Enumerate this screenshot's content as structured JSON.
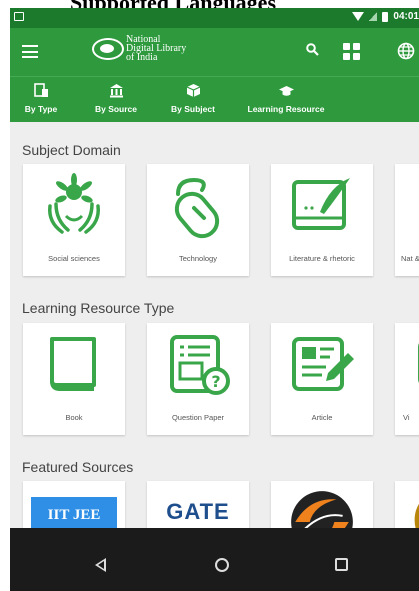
{
  "page_caption": "Supported Languages",
  "status_bar": {
    "time": "04:01"
  },
  "app_bar": {
    "logo_lines": [
      "National",
      "Digital Library",
      "of India"
    ]
  },
  "tabs": [
    {
      "label": "By Type",
      "icon": "file-phone-icon"
    },
    {
      "label": "By Source",
      "icon": "institution-icon"
    },
    {
      "label": "By Subject",
      "icon": "cube-book-icon"
    },
    {
      "label": "Learning Resource",
      "icon": "graduation-cap-icon"
    }
  ],
  "sections": {
    "subject_domain": {
      "title": "Subject Domain",
      "items": [
        {
          "label": "Social sciences",
          "icon": "people-hands-icon"
        },
        {
          "label": "Technology",
          "icon": "mouse-cable-icon"
        },
        {
          "label": "Literature & rhetoric",
          "icon": "quill-paper-icon"
        },
        {
          "label": "Nat & n",
          "icon": "science-icon"
        }
      ]
    },
    "learning_resource_type": {
      "title": "Learning Resource Type",
      "items": [
        {
          "label": "Book",
          "icon": "book-icon"
        },
        {
          "label": "Question Paper",
          "icon": "question-paper-icon"
        },
        {
          "label": "Article",
          "icon": "article-edit-icon"
        },
        {
          "label": "Vi",
          "icon": "video-icon"
        }
      ]
    },
    "featured_sources": {
      "title": "Featured Sources",
      "items": [
        {
          "label": "IIT JEE",
          "icon": "iit-jee-logo"
        },
        {
          "label": "GATE",
          "icon": "gate-logo"
        },
        {
          "label": "",
          "icon": "swayam-logo"
        },
        {
          "label": "",
          "icon": "seal-logo"
        }
      ]
    }
  },
  "colors": {
    "status_bar": "#1b7a2c",
    "app_bar": "#2e9a3d",
    "accent_icon": "#3aa64a",
    "nav_bar": "#1b1b1b"
  }
}
